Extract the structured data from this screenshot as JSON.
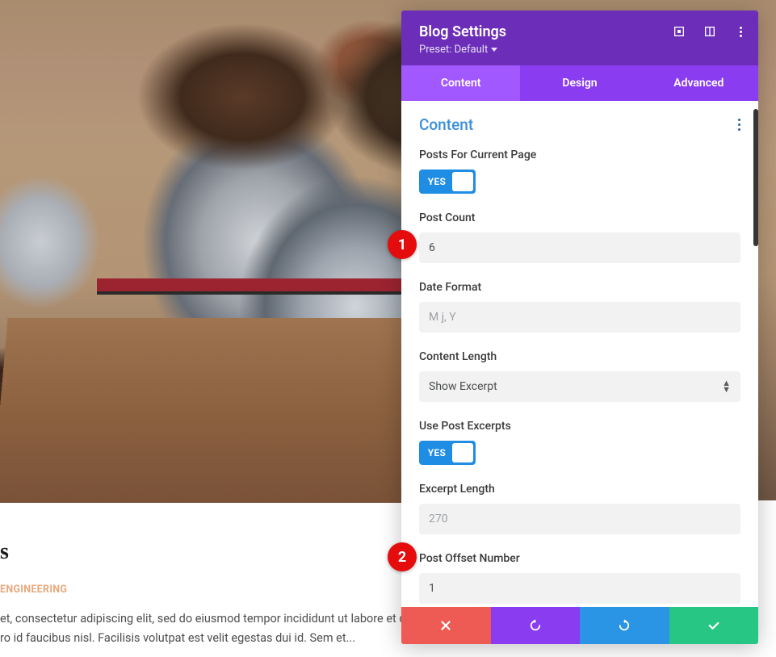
{
  "panel": {
    "title": "Blog Settings",
    "preset_label": "Preset: Default",
    "tabs": {
      "content": "Content",
      "design": "Design",
      "advanced": "Advanced"
    },
    "section_title": "Content",
    "fields": {
      "posts_current_page": {
        "label": "Posts For Current Page",
        "toggle": "YES"
      },
      "post_count": {
        "label": "Post Count",
        "value": "6"
      },
      "date_format": {
        "label": "Date Format",
        "placeholder": "M j, Y"
      },
      "content_length": {
        "label": "Content Length",
        "value": "Show Excerpt"
      },
      "use_post_excerpts": {
        "label": "Use Post Excerpts",
        "toggle": "YES"
      },
      "excerpt_length": {
        "label": "Excerpt Length",
        "placeholder": "270"
      },
      "post_offset": {
        "label": "Post Offset Number",
        "value": "1"
      }
    }
  },
  "article": {
    "heading": "s",
    "category": "ENGINEERING",
    "excerpt1": "et, consectetur adipiscing elit, sed do eiusmod tempor incididunt ut labore et do",
    "excerpt2": "ro id faucibus nisl. Facilisis volutpat est velit egestas dui id. Sem et..."
  },
  "annotations": {
    "b1": "1",
    "b2": "2"
  }
}
